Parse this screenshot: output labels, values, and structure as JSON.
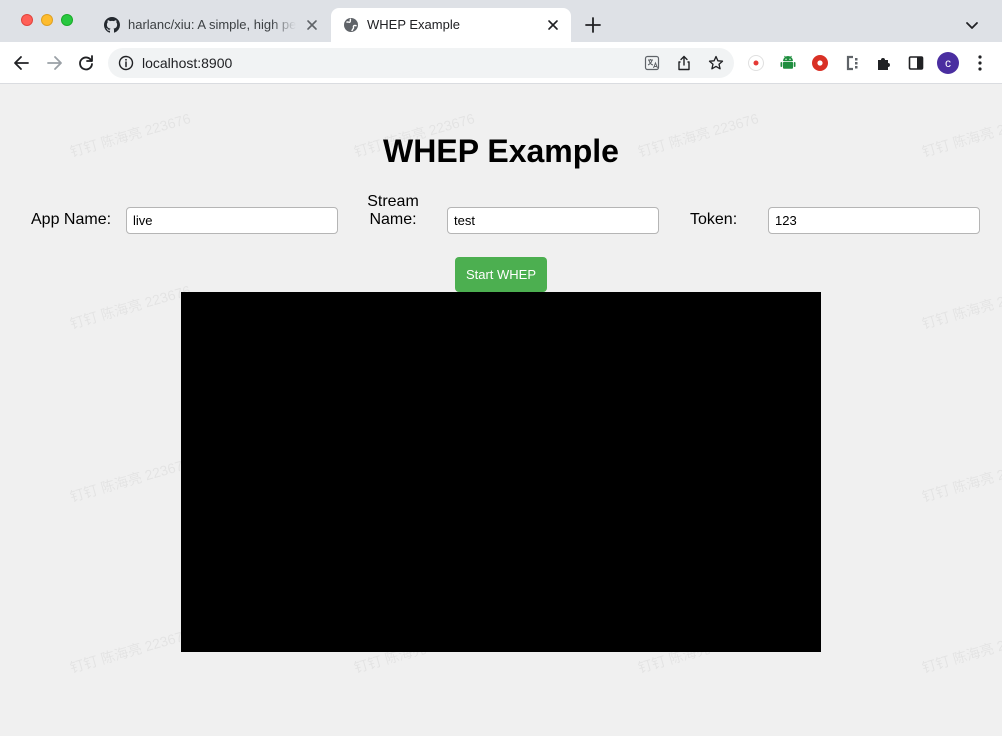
{
  "browser": {
    "tabs": [
      {
        "title": "harlanc/xiu: A simple, high performance and secure live media server",
        "icon": "github-icon",
        "active": false
      },
      {
        "title": "WHEP Example",
        "icon": "globe-icon",
        "active": true
      }
    ],
    "url": "localhost:8900",
    "profile_initial": "c"
  },
  "page": {
    "title": "WHEP Example",
    "app_name_label": "App Name:",
    "app_name_value": "live",
    "stream_name_label": "Stream Name:",
    "stream_name_line1": "Stream",
    "stream_name_line2": "Name:",
    "stream_name_value": "test",
    "token_label": "Token:",
    "token_value": "123",
    "start_button": "Start WHEP"
  },
  "watermark_text": "钉钉 陈海亮 223676",
  "colors": {
    "accent_button": "#4caf50",
    "video_background": "#000000",
    "page_background": "#f0f0f0"
  }
}
